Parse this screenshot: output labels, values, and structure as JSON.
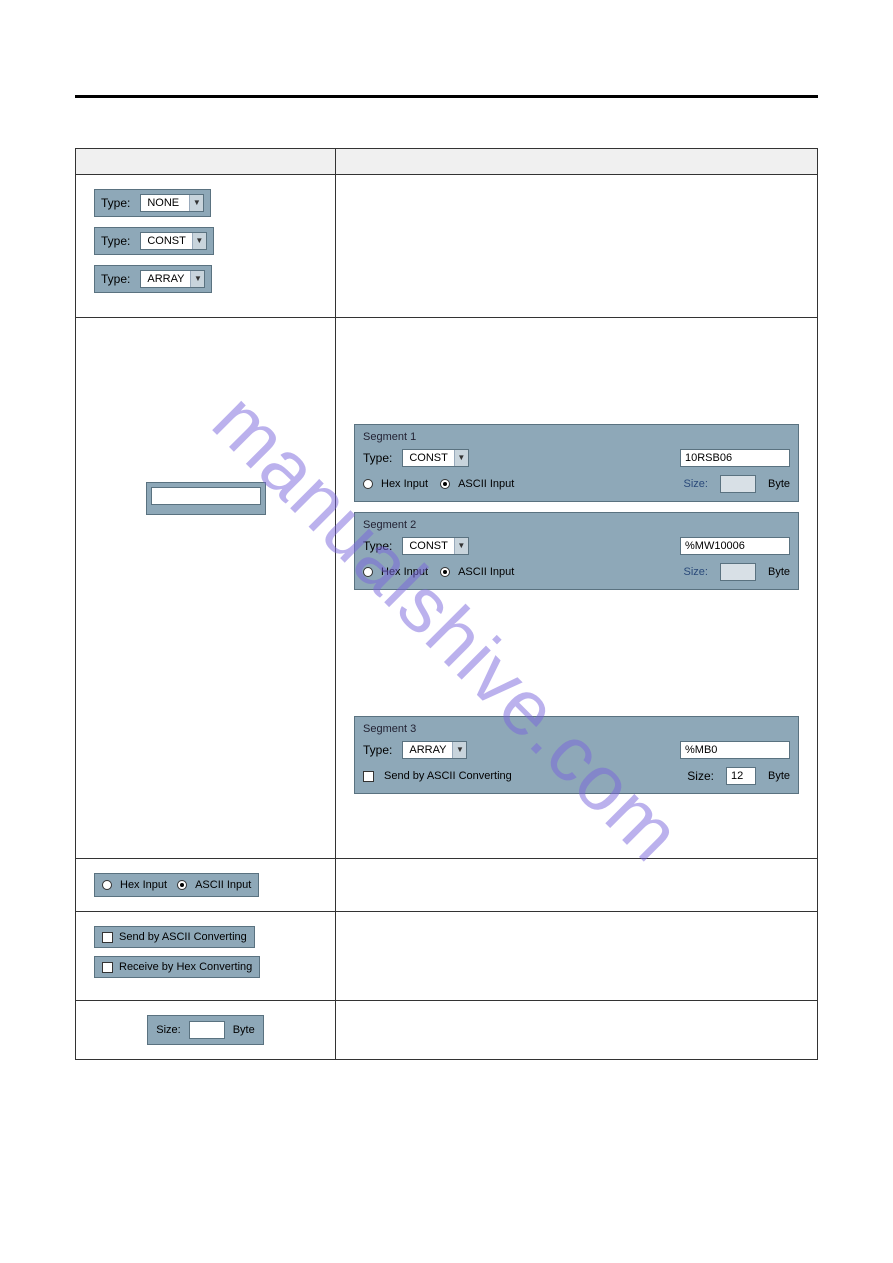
{
  "watermark": "manualshive.com",
  "row1": {
    "type_label": "Type:",
    "options": [
      "NONE",
      "CONST",
      "ARRAY"
    ]
  },
  "row2": {
    "left_input_value": "",
    "seg1": {
      "title": "Segment 1",
      "type_label": "Type:",
      "type_value": "CONST",
      "value": "10RSB06",
      "hex_label": "Hex Input",
      "ascii_label": "ASCII Input",
      "size_label": "Size:",
      "size_value": "",
      "byte_label": "Byte"
    },
    "seg2": {
      "title": "Segment 2",
      "type_label": "Type:",
      "type_value": "CONST",
      "value": "%MW10006",
      "hex_label": "Hex Input",
      "ascii_label": "ASCII Input",
      "size_label": "Size:",
      "size_value": "",
      "byte_label": "Byte"
    },
    "seg3": {
      "title": "Segment 3",
      "type_label": "Type:",
      "type_value": "ARRAY",
      "value": "%MB0",
      "conv_label": "Send by ASCII Converting",
      "size_label": "Size:",
      "size_value": "12",
      "byte_label": "Byte"
    }
  },
  "row3": {
    "hex_label": "Hex Input",
    "ascii_label": "ASCII Input"
  },
  "row4": {
    "send_label": "Send by ASCII Converting",
    "recv_label": "Receive by Hex Converting"
  },
  "row5": {
    "size_label": "Size:",
    "size_value": "",
    "byte_label": "Byte"
  }
}
